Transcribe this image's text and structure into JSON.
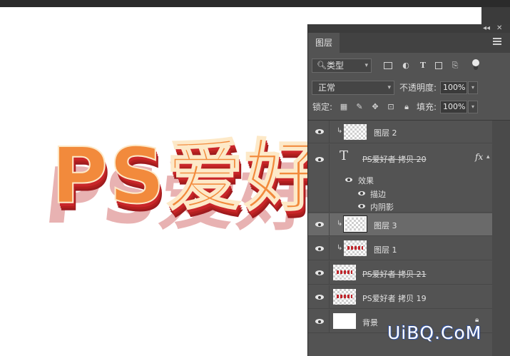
{
  "artwork": {
    "text": "PS爱好"
  },
  "panel": {
    "tab_label": "图层",
    "filter": {
      "kind": "类型"
    },
    "blend_mode": "正常",
    "opacity_label": "不透明度:",
    "opacity_value": "100%",
    "lock_label": "锁定:",
    "fill_label": "填充:",
    "fill_value": "100%"
  },
  "layers": [
    {
      "name": "图层 2",
      "type": "pixel",
      "clipped": true,
      "visible": true
    },
    {
      "name": "PS爱好者 拷贝 20",
      "type": "text",
      "visible": true,
      "fx": "fx",
      "effects_label": "效果",
      "effects": [
        "描边",
        "内阴影"
      ]
    },
    {
      "name": "图层 3",
      "type": "pixel",
      "clipped": true,
      "selected": true,
      "visible": true
    },
    {
      "name": "图层 1",
      "type": "pixel",
      "clipped": true,
      "visible": true
    },
    {
      "name": "PS爱好者 拷贝 21",
      "type": "pixel",
      "visible": true
    },
    {
      "name": "PS爱好者 拷贝 19",
      "type": "pixel",
      "visible": true
    },
    {
      "name": "背景",
      "type": "background",
      "visible": true,
      "locked": true
    }
  ],
  "watermark": "UiBQ.CoM",
  "colors": {
    "accent_orange": "#f28a3c",
    "accent_red": "#c9262a",
    "panel_bg": "#535353"
  }
}
